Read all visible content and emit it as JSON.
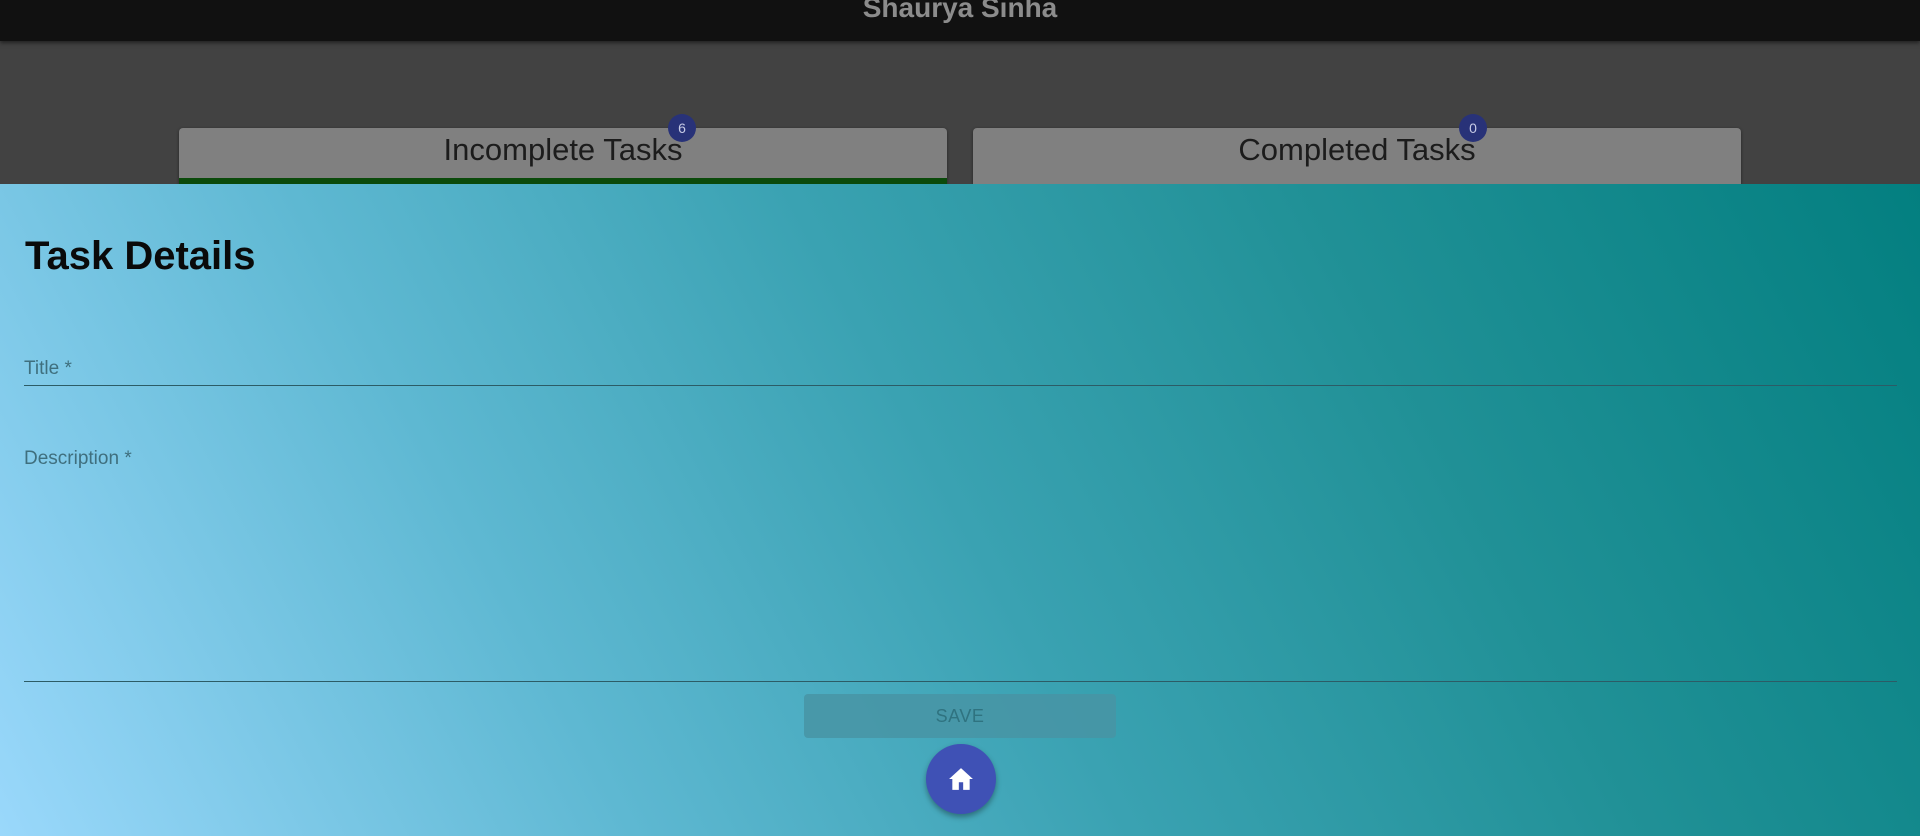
{
  "app_bar": {
    "title": "Shaurya Sinha"
  },
  "tabs": [
    {
      "label": "Incomplete Tasks",
      "badge": "6"
    },
    {
      "label": "Completed Tasks",
      "badge": "0"
    }
  ],
  "drawer": {
    "title": "Task Details",
    "fields": {
      "title": {
        "label": "Title *",
        "value": ""
      },
      "description": {
        "label": "Description *",
        "value": ""
      }
    },
    "save_label": "SAVE",
    "home_icon": "home-icon"
  },
  "colors": {
    "app_bar": "#111111",
    "tab_card": "#808080",
    "active_tab_indicator": "#0b4a0b",
    "badge": "#283278",
    "fab": "#3f51b5",
    "drawer_gradient_start": "#9ad8fb",
    "drawer_gradient_end": "#037f80"
  }
}
